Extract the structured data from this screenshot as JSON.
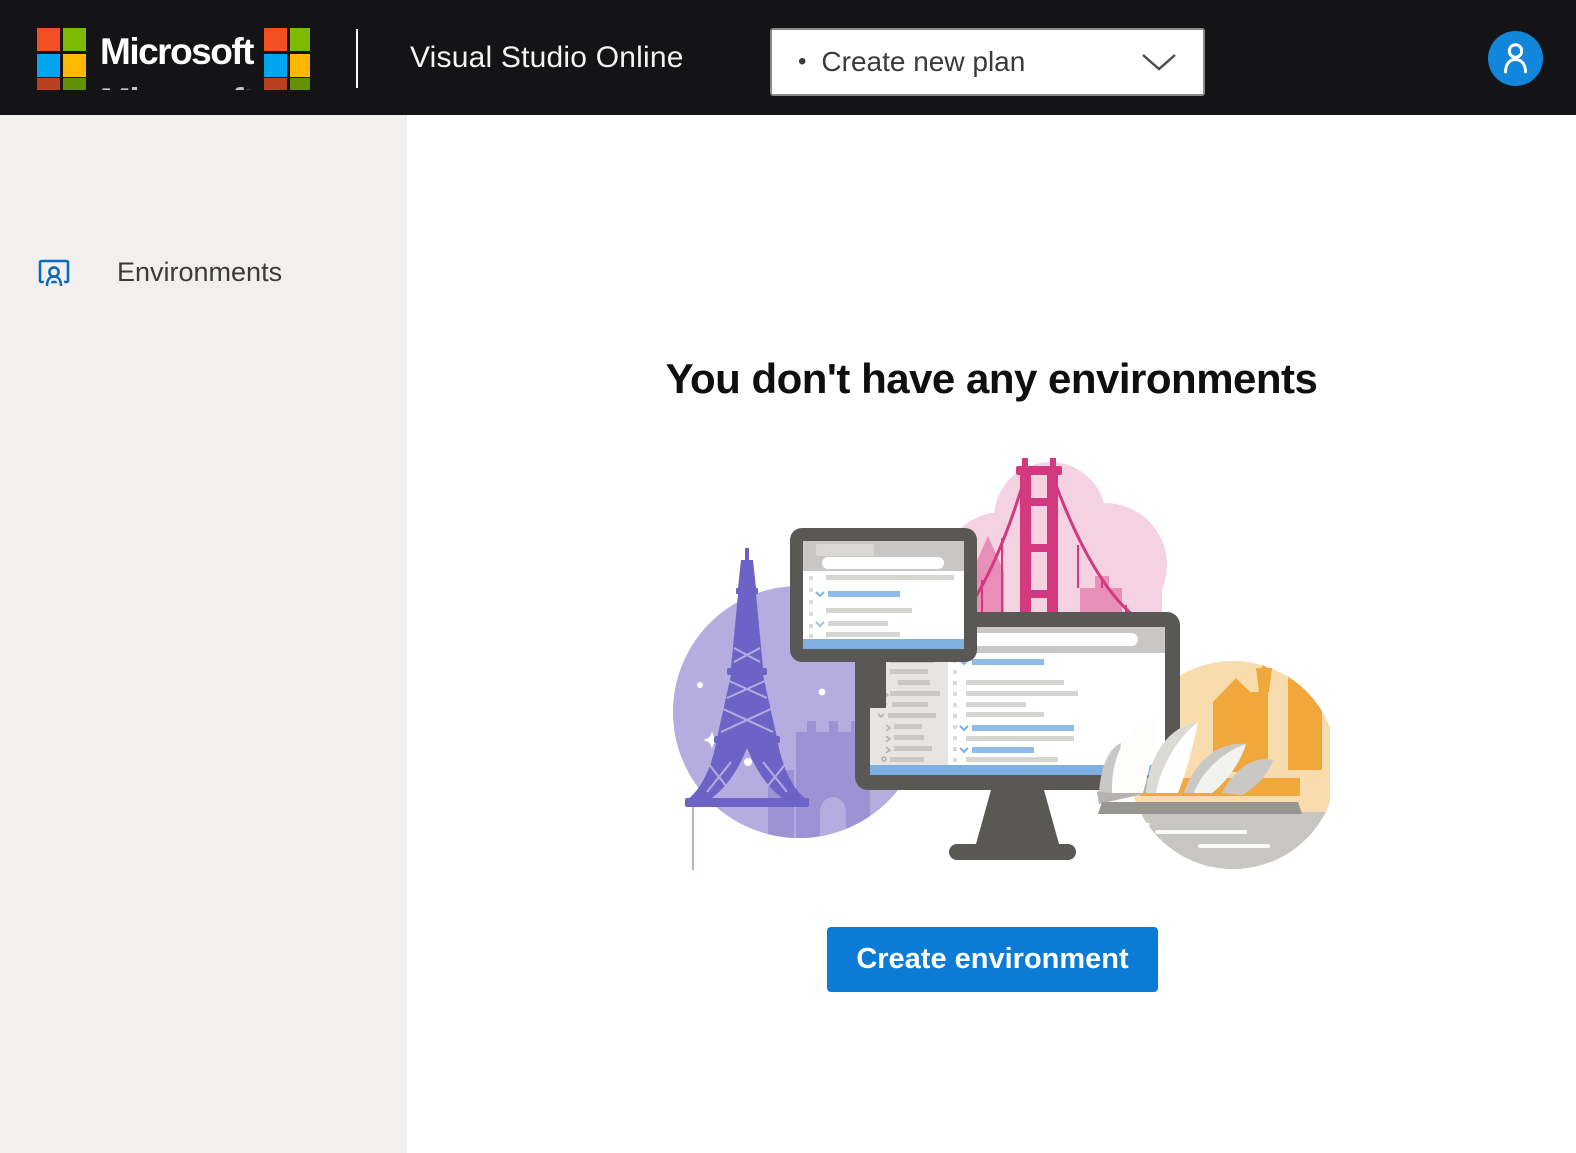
{
  "header": {
    "background": "#141416",
    "brand": {
      "name": "Microsoft",
      "square_colors": {
        "top_left": "#f25022",
        "top_right": "#7fba00",
        "bottom_left": "#00a4ef",
        "bottom_right": "#ffb900"
      }
    },
    "product_title": "Visual Studio Online",
    "plan_selector": {
      "bullet": "•",
      "value": "Create new plan",
      "icon": "chevron-down-icon"
    },
    "avatar": {
      "icon": "person-icon",
      "color": "#1186da"
    }
  },
  "sidebar": {
    "background": "#f1f0ee",
    "items": [
      {
        "label": "Environments",
        "icon": "environments-person-frame-icon",
        "icon_color": "#1068bf"
      }
    ]
  },
  "main": {
    "empty_state": {
      "title": "You don't have any environments",
      "button_label": "Create environment",
      "button_color": "#0c7bd6",
      "illustration": {
        "name": "world-landmarks-and-code-monitors",
        "colors": {
          "purple_circle": "#b5ace0",
          "eiffel_tower": "#6d63c6",
          "pink_cloud": "#f4d2e2",
          "golden_gate": "#d2397f",
          "orange_circle": "#f9dcae",
          "sydney_buildings": "#f0a73c",
          "monitor_frame": "#595855",
          "screen_blue_accent": "#7fb0e2",
          "screen_gray_bars": "#d6d5d2"
        }
      }
    }
  }
}
